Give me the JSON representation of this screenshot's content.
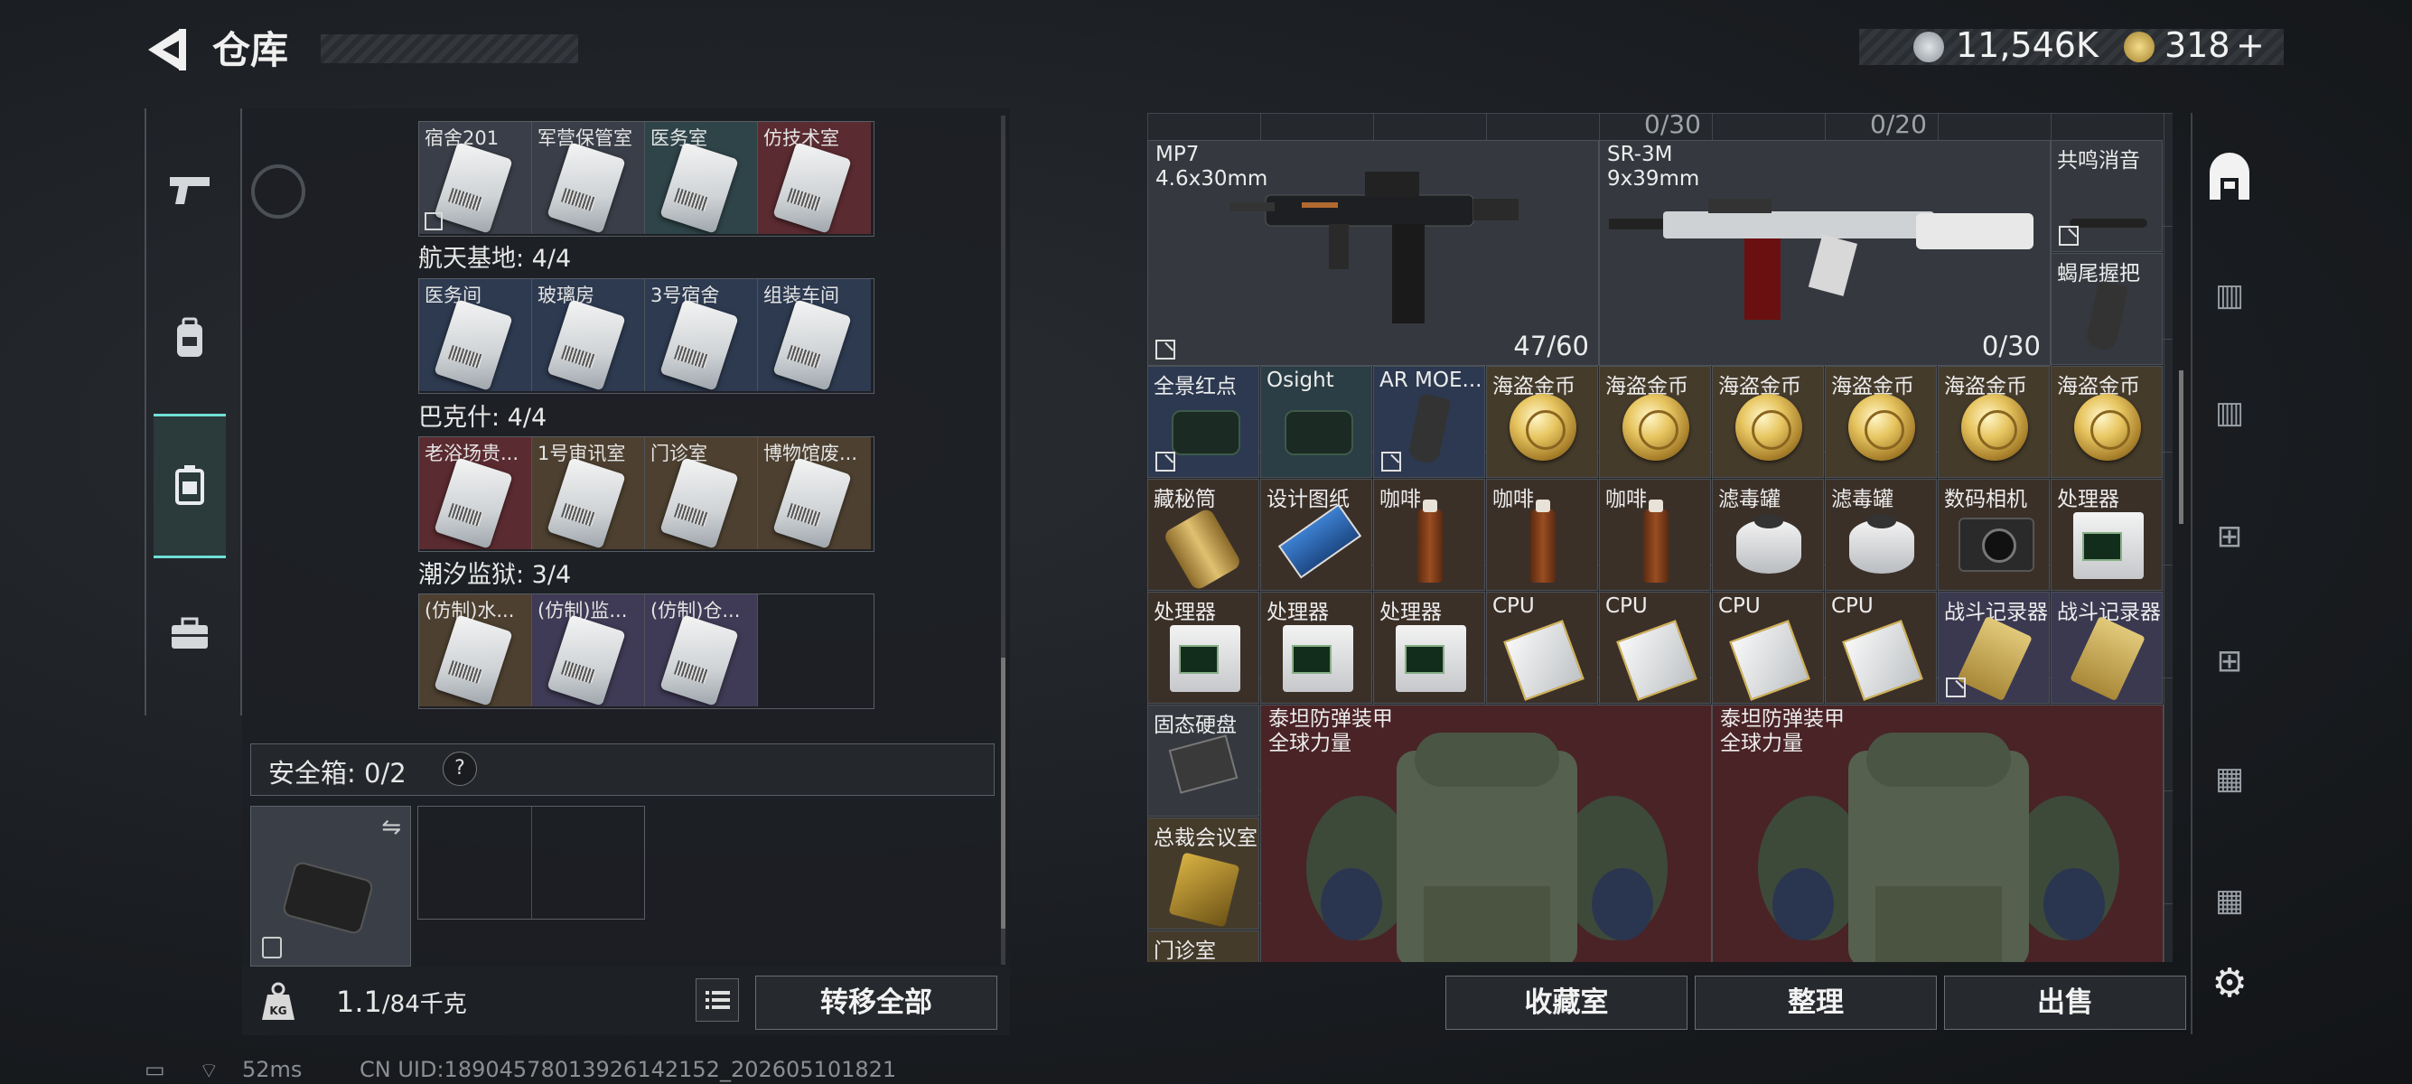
{
  "header": {
    "title": "仓库",
    "currency_silver": "11,546K",
    "currency_gold": "318",
    "plus": "+"
  },
  "nav": {
    "icons": [
      "pistol-icon",
      "backpack-icon",
      "container-icon",
      "toolbox-icon"
    ]
  },
  "left_panel": {
    "groups": [
      {
        "title": "",
        "slots": [
          {
            "label": "宿舍201",
            "bg": "bg-gray"
          },
          {
            "label": "军营保管室",
            "bg": "bg-gray"
          },
          {
            "label": "医务室",
            "bg": "bg-teal"
          },
          {
            "label": "仿技术室",
            "bg": "bg-red"
          }
        ]
      },
      {
        "title": "航天基地: 4/4",
        "slots": [
          {
            "label": "医务间",
            "bg": "bg-blue"
          },
          {
            "label": "玻璃房",
            "bg": "bg-blue"
          },
          {
            "label": "3号宿舍",
            "bg": "bg-blue"
          },
          {
            "label": "组装车间",
            "bg": "bg-blue"
          }
        ]
      },
      {
        "title": "巴克什: 4/4",
        "slots": [
          {
            "label": "老浴场贵...",
            "bg": "bg-red"
          },
          {
            "label": "1号审讯室",
            "bg": "bg-gold"
          },
          {
            "label": "门诊室",
            "bg": "bg-gold"
          },
          {
            "label": "博物馆废...",
            "bg": "bg-gold"
          }
        ]
      },
      {
        "title": "潮汐监狱: 3/4",
        "slots": [
          {
            "label": "(仿制)水...",
            "bg": "bg-gold"
          },
          {
            "label": "(仿制)监...",
            "bg": "bg-purple"
          },
          {
            "label": "(仿制)仓...",
            "bg": "bg-purple"
          },
          {
            "label": "",
            "bg": ""
          }
        ]
      }
    ],
    "safe_box_label": "安全箱: 0/2",
    "help": "?",
    "weight_value": "1.1",
    "weight_capacity": "/84千克",
    "transfer_all": "转移全部"
  },
  "stash": {
    "counters": [
      "0/30",
      "0/20"
    ],
    "weapons": [
      {
        "name": "MP7",
        "caliber": "4.6x30mm",
        "ammo": "47/60"
      },
      {
        "name": "SR-3M",
        "caliber": "9x39mm",
        "ammo": "0/30"
      }
    ],
    "side_items": [
      "共鸣消音",
      "蝎尾握把"
    ],
    "row1": [
      "全景红点",
      "Osight",
      "AR MOE...",
      "海盗金币",
      "海盗金币",
      "海盗金币",
      "海盗金币",
      "海盗金币",
      "海盗金币"
    ],
    "row2": [
      "藏秘筒",
      "设计图纸",
      "咖啡",
      "咖啡",
      "咖啡",
      "滤毒罐",
      "滤毒罐",
      "数码相机",
      "处理器"
    ],
    "row3": [
      "处理器",
      "处理器",
      "处理器",
      "CPU",
      "CPU",
      "CPU",
      "CPU",
      "战斗记录器",
      "战斗记录器"
    ],
    "small_col": [
      "固态硬盘",
      "总裁会议室",
      "门诊室"
    ],
    "armor": [
      {
        "name": "泰坦防弹装甲",
        "sub": "全球力量"
      },
      {
        "name": "泰坦防弹装甲",
        "sub": "全球力量"
      }
    ]
  },
  "actions": {
    "collection": "收藏室",
    "organize": "整理",
    "sell": "出售"
  },
  "status": {
    "ping": "52ms",
    "uid": "CN UID:18904578013926142152_202605101821"
  }
}
